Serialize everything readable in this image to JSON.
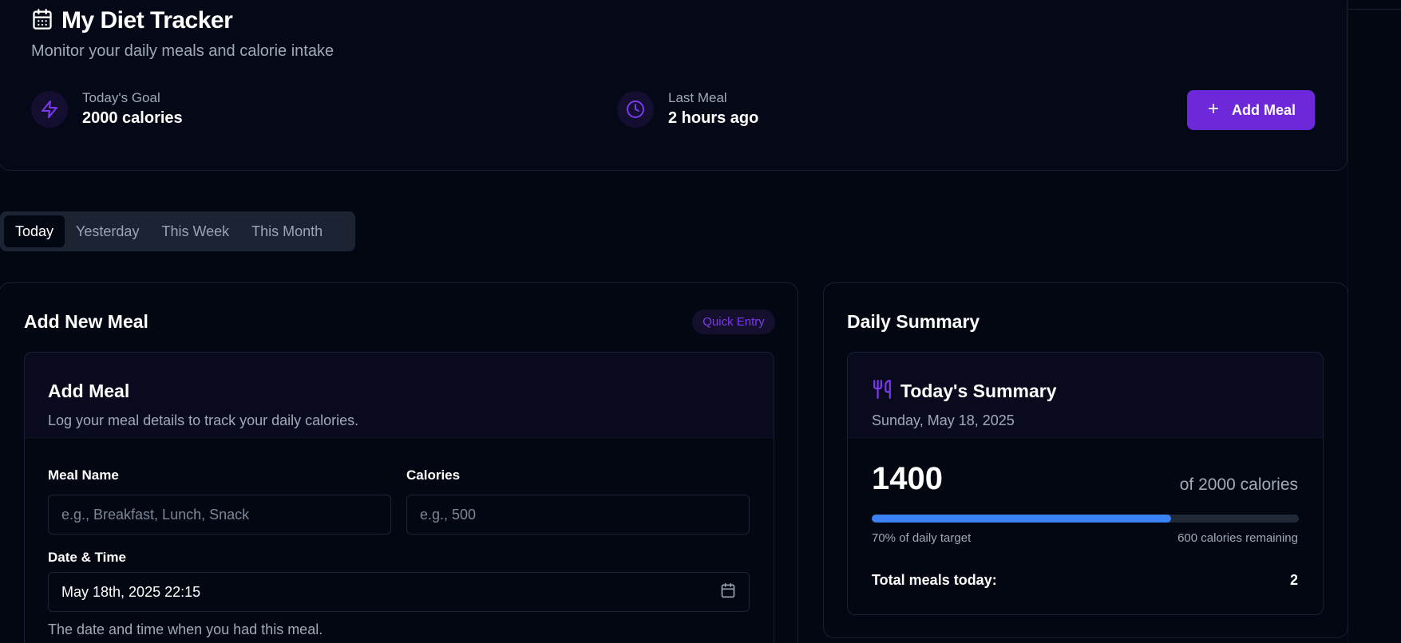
{
  "header": {
    "title": "My Diet Tracker",
    "subtitle": "Monitor your daily meals and calorie intake",
    "goal": {
      "label": "Today's Goal",
      "value": "2000 calories"
    },
    "last_meal": {
      "label": "Last Meal",
      "value": "2 hours ago"
    },
    "add_meal_label": "Add Meal"
  },
  "tabs": [
    {
      "label": "Today",
      "active": true
    },
    {
      "label": "Yesterday",
      "active": false
    },
    {
      "label": "This Week",
      "active": false
    },
    {
      "label": "This Month",
      "active": false
    }
  ],
  "add_panel": {
    "title": "Add New Meal",
    "badge": "Quick Entry",
    "card_title": "Add Meal",
    "card_description": "Log your meal details to track your daily calories.",
    "meal_name_label": "Meal Name",
    "meal_name_placeholder": "e.g., Breakfast, Lunch, Snack",
    "calories_label": "Calories",
    "calories_placeholder": "e.g., 500",
    "datetime_label": "Date & Time",
    "datetime_value": "May 18th, 2025 22:15",
    "datetime_helper": "The date and time when you had this meal."
  },
  "summary_panel": {
    "title": "Daily Summary",
    "card_title": "Today's Summary",
    "date": "Sunday, May 18, 2025",
    "consumed": "1400",
    "of_total": "of 2000 calories",
    "progress_fraction": 0.7,
    "percent_text": "70% of daily target",
    "remaining_text": "600 calories remaining",
    "total_meals_label": "Total meals today:",
    "total_meals_value": "2"
  },
  "colors": {
    "accent": "#6d28d9",
    "icon_accent": "#7c3aed",
    "progress": "#3b82f6",
    "background": "#030712"
  },
  "icons": [
    "calendar-icon",
    "zap-icon",
    "clock-icon",
    "plus-icon",
    "utensils-icon"
  ]
}
